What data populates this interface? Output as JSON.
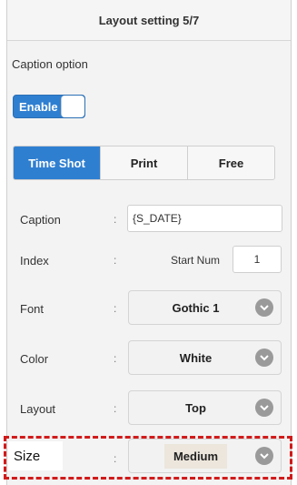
{
  "header": {
    "title": "Layout setting 5/7"
  },
  "caption_option": {
    "label": "Caption option",
    "toggle_label": "Enable",
    "toggle_state": "on"
  },
  "tabs": [
    {
      "label": "Time Shot",
      "active": true
    },
    {
      "label": "Print",
      "active": false
    },
    {
      "label": "Free",
      "active": false
    }
  ],
  "separator": ":",
  "fields": {
    "caption": {
      "label": "Caption",
      "value": "{S_DATE}"
    },
    "index": {
      "label": "Index",
      "start_label": "Start Num",
      "start_value": "1"
    },
    "font": {
      "label": "Font",
      "value": "Gothic 1"
    },
    "color": {
      "label": "Color",
      "value": "White"
    },
    "layout": {
      "label": "Layout",
      "value": "Top"
    },
    "size": {
      "label": "Size",
      "value": "Medium"
    }
  },
  "colors": {
    "accent": "#2f7fd1",
    "highlight": "#d11a1a"
  }
}
